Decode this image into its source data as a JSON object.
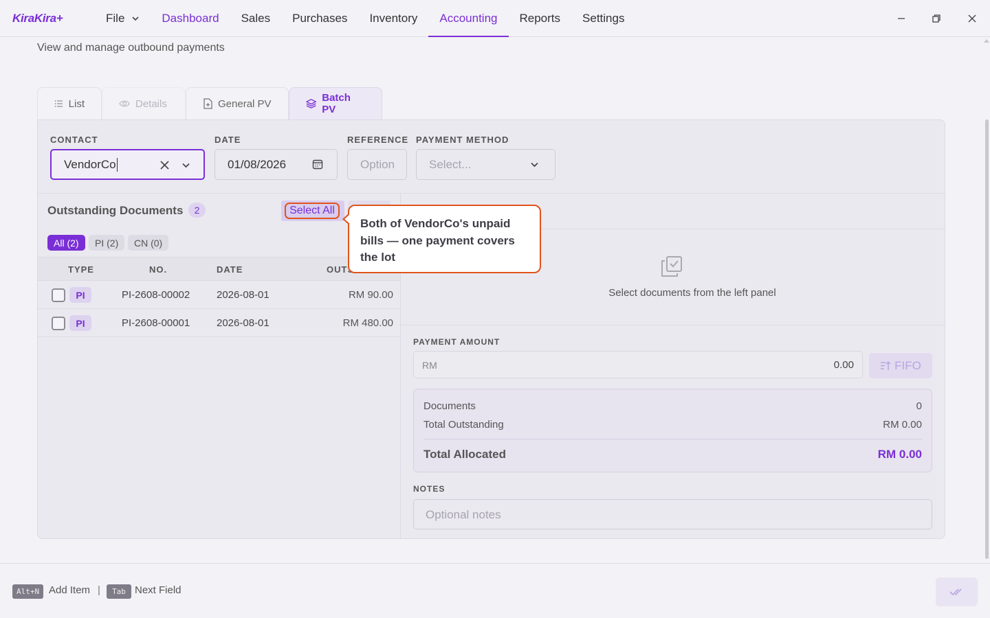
{
  "app": {
    "brand": "KiraKira+"
  },
  "menu": {
    "items": [
      "File",
      "Dashboard",
      "Sales",
      "Purchases",
      "Inventory",
      "Accounting",
      "Reports",
      "Settings"
    ]
  },
  "page": {
    "subtitle": "View and manage outbound payments"
  },
  "tabs": [
    "List",
    "Details",
    "General PV",
    "Batch PV"
  ],
  "form": {
    "contact_label": "CONTACT",
    "contact_value": "VendorCo",
    "date_label": "DATE",
    "date_value": "01/08/2026",
    "reference_label": "REFERENCE",
    "reference_placeholder": "Option",
    "payment_method_label": "PAYMENT METHOD",
    "payment_method_placeholder": "Select..."
  },
  "outstanding": {
    "title": "Outstanding Documents",
    "count": "2",
    "select_all": "Select All",
    "filters": [
      "All (2)",
      "PI (2)",
      "CN (0)"
    ],
    "columns": [
      "TYPE",
      "NO.",
      "DATE",
      "OUTS"
    ],
    "rows": [
      {
        "type": "PI",
        "no": "PI-2608-00002",
        "date": "2026-08-01",
        "amount": "RM 90.00"
      },
      {
        "type": "PI",
        "no": "PI-2608-00001",
        "date": "2026-08-01",
        "amount": "RM 480.00"
      }
    ]
  },
  "callout": {
    "text": "Both of VendorCo's unpaid bills — one payment covers the lot"
  },
  "selected": {
    "empty_text": "Select documents from the left panel"
  },
  "payment": {
    "amount_label": "PAYMENT AMOUNT",
    "currency": "RM",
    "amount": "0.00",
    "fifo_label": "FIFO"
  },
  "summary": {
    "documents_label": "Documents",
    "documents_value": "0",
    "outstanding_label": "Total Outstanding",
    "outstanding_value": "RM 0.00",
    "allocated_label": "Total Allocated",
    "allocated_value": "RM 0.00"
  },
  "notes": {
    "label": "NOTES",
    "placeholder": "Optional notes"
  },
  "footer": {
    "key1": "Alt+N",
    "hint1": "Add Item",
    "separator": "|",
    "key2": "Tab",
    "hint2": "Next Field"
  },
  "colors": {
    "accent": "#7a2fd6",
    "callout_border": "#e0531a"
  }
}
